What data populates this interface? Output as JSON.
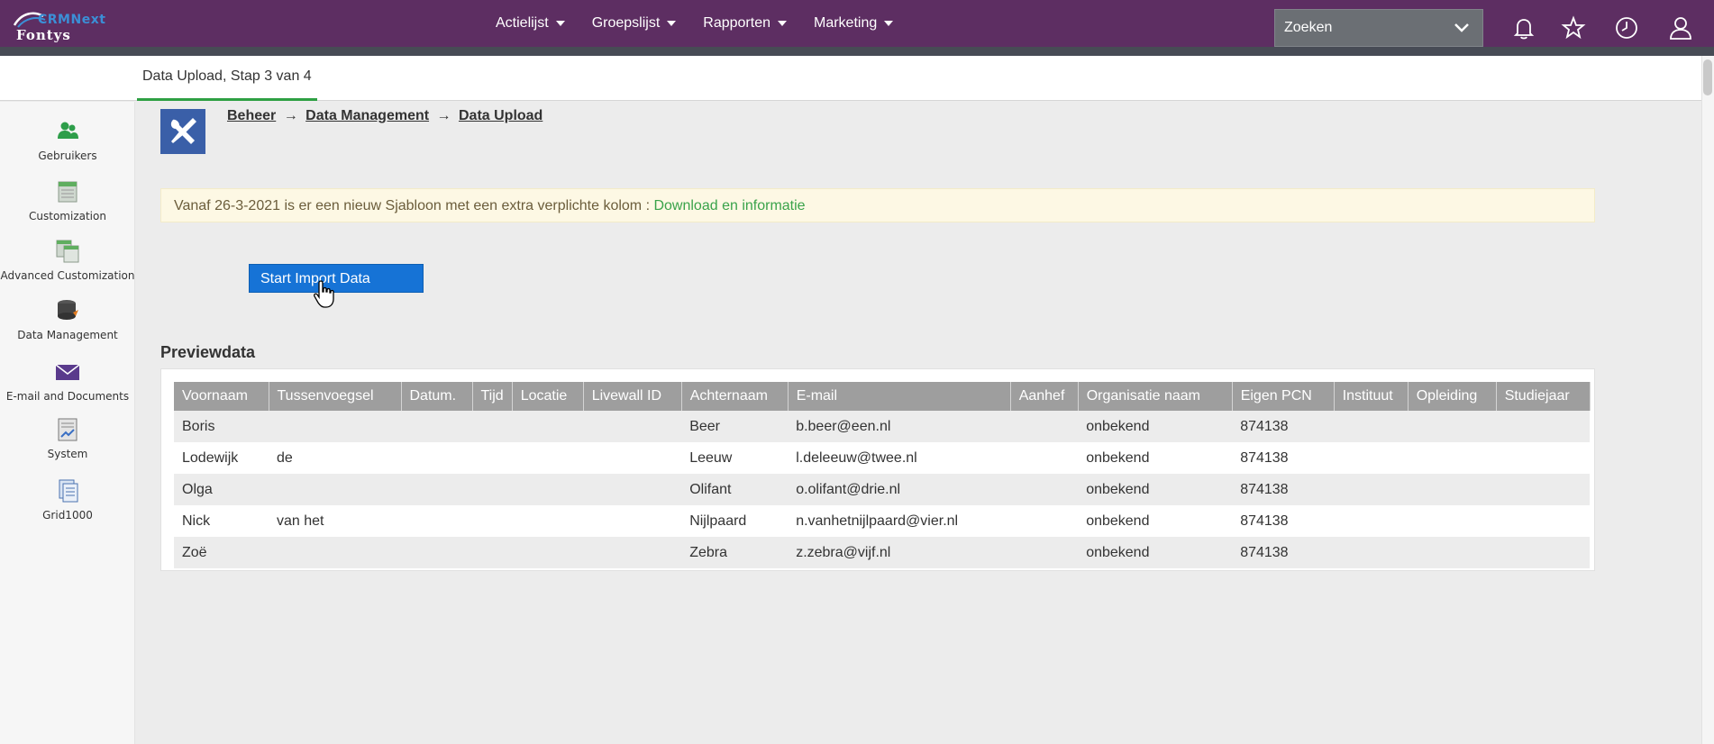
{
  "app": {
    "logo_top": "CRMNext",
    "logo_bottom": "Fontys"
  },
  "nav": {
    "items": [
      {
        "label": "Actielijst"
      },
      {
        "label": "Groepslijst"
      },
      {
        "label": "Rapporten"
      },
      {
        "label": "Marketing"
      }
    ],
    "search_placeholder": "Zoeken",
    "icons": [
      "bell-icon",
      "star-icon",
      "clock-icon",
      "user-icon"
    ]
  },
  "tab": {
    "active_label": "Data Upload, Stap 3 van 4"
  },
  "sidebar": {
    "items": [
      {
        "label": "Gebruikers",
        "icon": "users-icon"
      },
      {
        "label": "Customization",
        "icon": "customization-icon"
      },
      {
        "label": "Advanced Customization",
        "icon": "advanced-customization-icon"
      },
      {
        "label": "Data Management",
        "icon": "database-icon"
      },
      {
        "label": "E-mail and Documents",
        "icon": "envelope-icon"
      },
      {
        "label": "System",
        "icon": "system-icon"
      },
      {
        "label": "Grid1000",
        "icon": "grid-icon"
      }
    ]
  },
  "breadcrumb": {
    "items": [
      "Beheer",
      "Data Management",
      "Data Upload"
    ],
    "separator": "→"
  },
  "notice": {
    "text": "Vanaf 26-3-2021 is er een nieuw Sjabloon met een extra verplichte kolom :",
    "link": "Download en informatie"
  },
  "import_button": {
    "label": "Start Import Data"
  },
  "preview": {
    "title": "Previewdata",
    "columns": [
      "Voornaam",
      "Tussenvoegsel",
      "Datum.",
      "Tijd",
      "Locatie",
      "Livewall ID",
      "Achternaam",
      "E-mail",
      "Aanhef",
      "Organisatie naam",
      "Eigen PCN",
      "Instituut",
      "Opleiding",
      "Studiejaar"
    ],
    "rows": [
      [
        "Boris",
        "",
        "",
        "",
        "",
        "",
        "Beer",
        "b.beer@een.nl",
        "",
        "onbekend",
        "874138",
        "",
        "",
        ""
      ],
      [
        "Lodewijk",
        "de",
        "",
        "",
        "",
        "",
        "Leeuw",
        "l.deleeuw@twee.nl",
        "",
        "onbekend",
        "874138",
        "",
        "",
        ""
      ],
      [
        "Olga",
        "",
        "",
        "",
        "",
        "",
        "Olifant",
        "o.olifant@drie.nl",
        "",
        "onbekend",
        "874138",
        "",
        "",
        ""
      ],
      [
        "Nick",
        "van het",
        "",
        "",
        "",
        "",
        "Nijlpaard",
        "n.vanhetnijlpaard@vier.nl",
        "",
        "onbekend",
        "874138",
        "",
        "",
        ""
      ],
      [
        "Zoë",
        "",
        "",
        "",
        "",
        "",
        "Zebra",
        "z.zebra@vijf.nl",
        "",
        "onbekend",
        "874138",
        "",
        "",
        ""
      ]
    ]
  },
  "colors": {
    "topbar": "#5d2e62",
    "accent_blue": "#1673d6",
    "tab_underline": "#2ea043",
    "notice_link": "#3aa34a"
  }
}
